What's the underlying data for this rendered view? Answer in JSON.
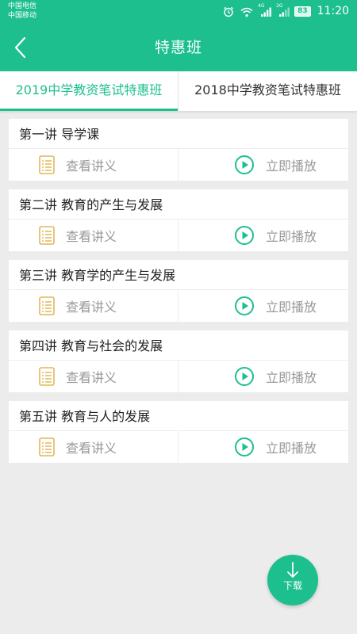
{
  "status_bar": {
    "carrier_1": "中国电信",
    "carrier_2": "中国移动",
    "signal_1_label": "4G",
    "signal_2_label": "2G",
    "battery": "83",
    "time": "11:20"
  },
  "nav": {
    "title": "特惠班",
    "back_icon": "chevron-left-icon"
  },
  "tabs": [
    {
      "label": "2019中学教资笔试特惠班",
      "active": true
    },
    {
      "label": "2018中学教资笔试特惠班",
      "active": false
    }
  ],
  "lessons": [
    {
      "title": "第一讲 导学课",
      "notes_label": "查看讲义",
      "play_label": "立即播放"
    },
    {
      "title": "第二讲 教育的产生与发展",
      "notes_label": "查看讲义",
      "play_label": "立即播放"
    },
    {
      "title": "第三讲 教育学的产生与发展",
      "notes_label": "查看讲义",
      "play_label": "立即播放"
    },
    {
      "title": "第四讲 教育与社会的发展",
      "notes_label": "查看讲义",
      "play_label": "立即播放"
    },
    {
      "title": "第五讲 教育与人的发展",
      "notes_label": "查看讲义",
      "play_label": "立即播放"
    }
  ],
  "download": {
    "label": "下载",
    "icon": "arrow-down-icon"
  },
  "colors": {
    "accent": "#1dbf8e",
    "notes_icon": "#e0b75a",
    "background": "#ececec"
  }
}
